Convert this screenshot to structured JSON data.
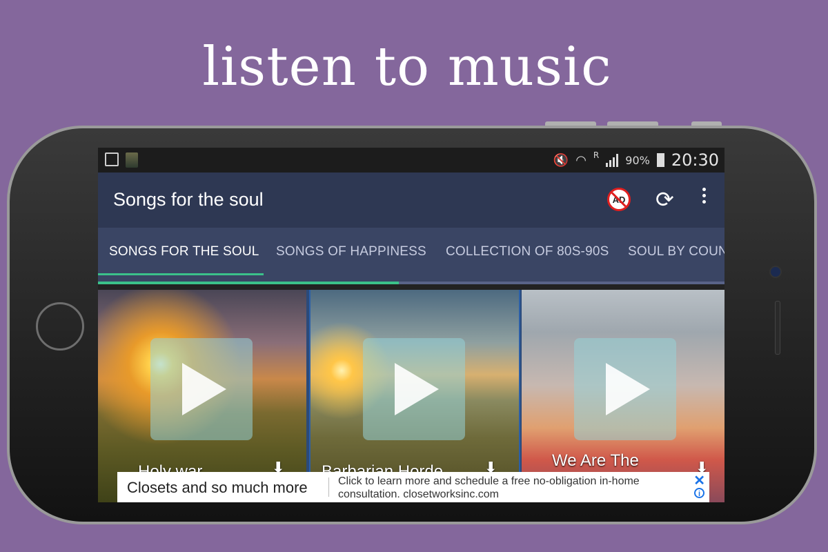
{
  "headline": "listen to music",
  "statusbar": {
    "signal_label": "R",
    "battery": "90%",
    "time": "20:30"
  },
  "appbar": {
    "title": "Songs for the soul",
    "noad_label": "AD"
  },
  "tabs": [
    {
      "label": "SONGS FOR THE SOUL"
    },
    {
      "label": "SONGS OF HAPPINESS"
    },
    {
      "label": "COLLECTION OF 80S-90S"
    },
    {
      "label": "SOUL BY COUNT"
    }
  ],
  "progress": 0.48,
  "cards": [
    {
      "title": "Holy war"
    },
    {
      "title": "Barbarian Horde"
    },
    {
      "title": "We Are The"
    }
  ],
  "ad": {
    "headline": "Closets and so much more",
    "body": "Click to learn more and schedule a free no-obligation in-home consultation. closetworksinc.com",
    "close": "✕",
    "info": "i"
  },
  "colors": {
    "background": "#84679c",
    "appbar": "#2e3853",
    "tabs": "#3a4564",
    "accent": "#3bc18a"
  }
}
